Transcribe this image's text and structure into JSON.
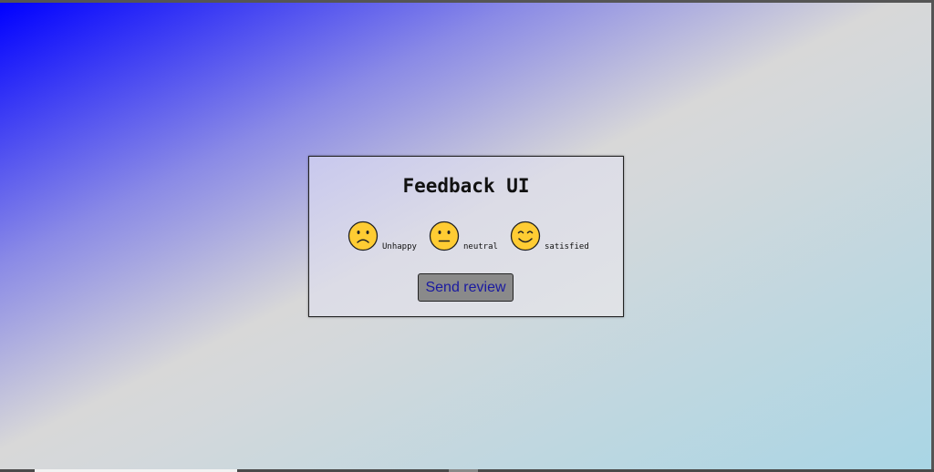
{
  "card": {
    "title": "Feedback UI",
    "ratings": [
      {
        "label": "Unhappy",
        "icon": "sad-face-icon"
      },
      {
        "label": "neutral",
        "icon": "neutral-face-icon"
      },
      {
        "label": "satisfied",
        "icon": "smiling-face-icon"
      }
    ],
    "send_label": "Send review"
  },
  "colors": {
    "gradient_start": "#0000ff",
    "gradient_end": "#add8e6",
    "button_bg": "#8a8a8a",
    "button_text": "#1a1aa0",
    "face_yellow": "#ffcc33"
  }
}
